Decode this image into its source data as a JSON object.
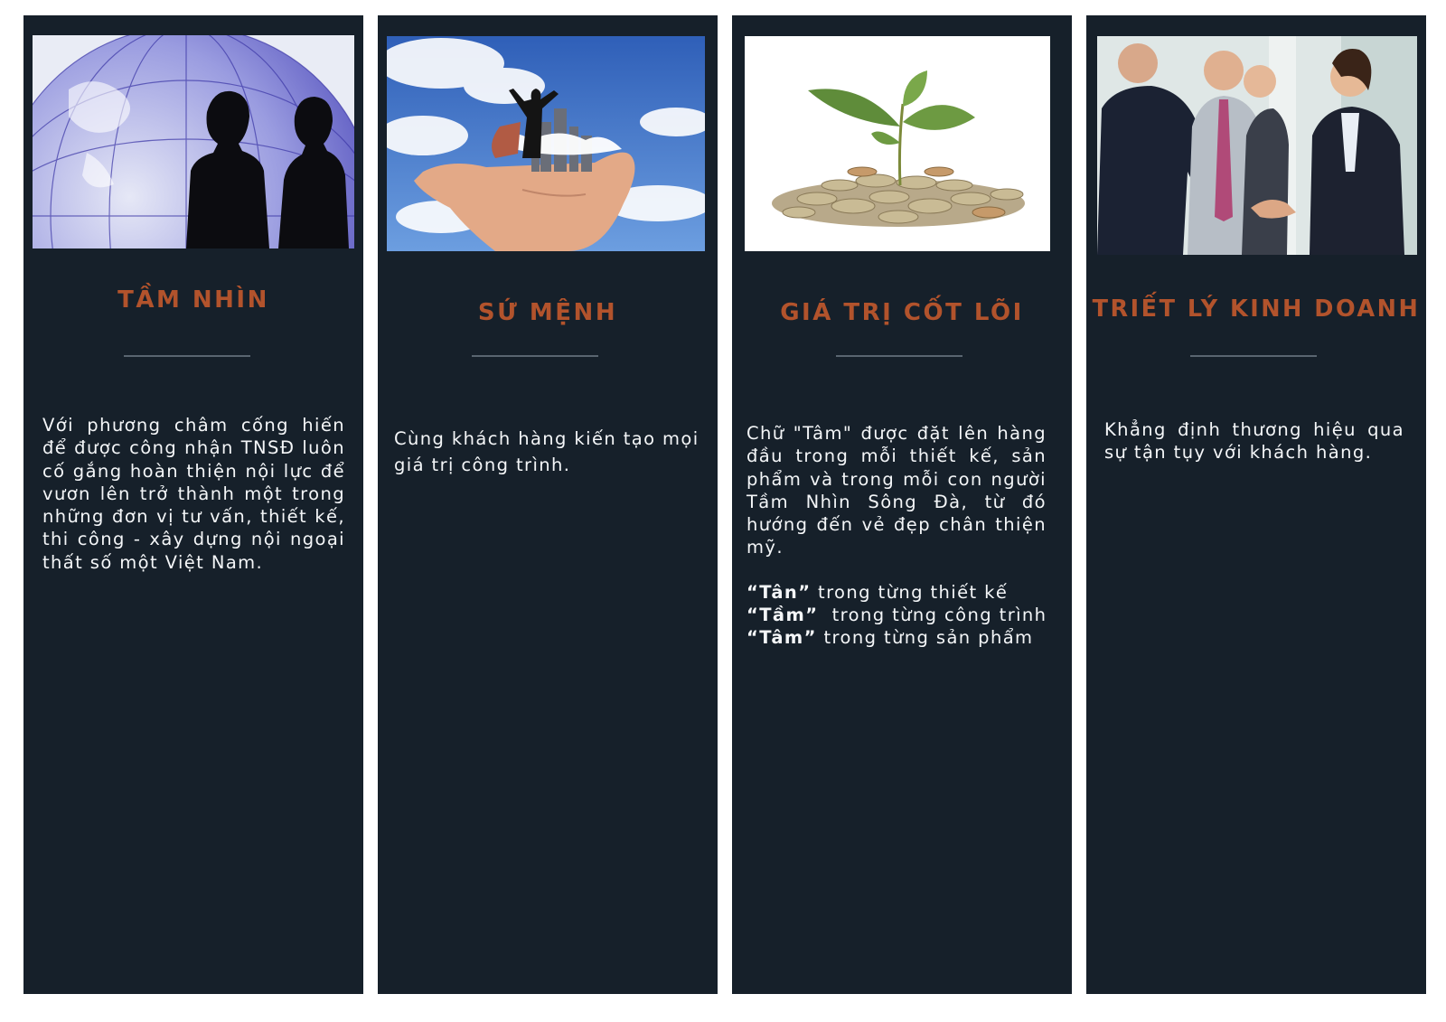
{
  "panels": [
    {
      "title": "TẦM NHÌN",
      "image": "two businessmen silhouettes in front of a globe",
      "body": "Với phương châm cống hiến để được công nhận TNSĐ luôn cố gắng hoàn thiện nội lực để vươn lên trở thành một trong những đơn vị tư vấn, thiết kế, thi công - xây dựng nội ngoại thất số một Việt Nam."
    },
    {
      "title": "SỨ MỆNH",
      "image": "hand holding a city with a businessman on top, sky background",
      "body": "Cùng khách hàng kiến tạo mọi giá trị công trình."
    },
    {
      "title": "GIÁ TRỊ CỐT LÕI",
      "image": "green sprout growing from a pile of coins",
      "body": "Chữ \"Tâm\" được đặt lên hàng đầu trong mỗi thiết kế, sản phẩm và trong mỗi con người Tầm Nhìn Sông Đà, từ đó hướng đến vẻ đẹp chân thiện mỹ.",
      "lines": [
        {
          "key": "“Tân”",
          "text": " trong từng thiết kế"
        },
        {
          "key": "“Tầm”",
          "text": "  trong từng công trình"
        },
        {
          "key": "“Tâm”",
          "text": " trong từng sản phẩm"
        }
      ]
    },
    {
      "title": "TRIẾT LÝ KINH DOANH",
      "image": "business people shaking hands",
      "body": "Khẳng định thương hiệu qua sự tận tụy với khách hàng."
    }
  ],
  "colors": {
    "panel": "#16202a",
    "title": "#b2532c",
    "text": "#f4f6f8",
    "rule": "#596570"
  }
}
